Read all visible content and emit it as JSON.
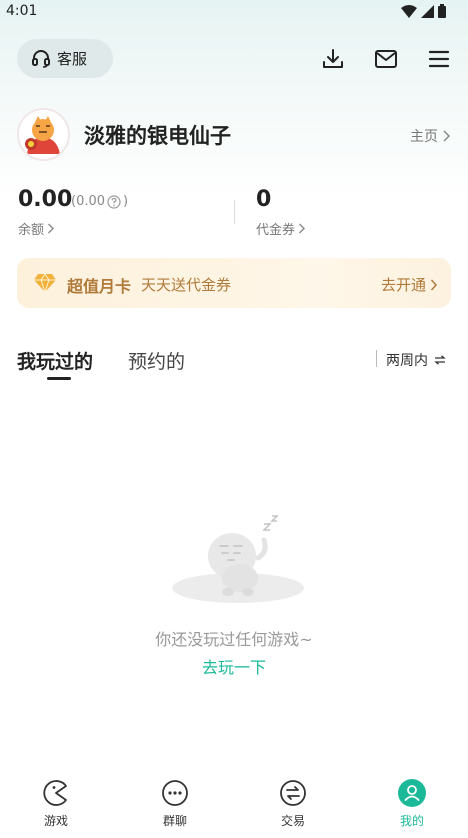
{
  "status_bar": {
    "time": "4:01"
  },
  "header": {
    "customer_service_label": "客服",
    "icons": [
      "download-icon",
      "mail-icon",
      "menu-icon"
    ]
  },
  "profile": {
    "nickname": "淡雅的银电仙子",
    "homepage_link": "主页"
  },
  "wallet": {
    "balance_value": "0.00",
    "balance_sub_value": "(0.00",
    "balance_sub_close": ")",
    "balance_label": "余额",
    "coupon_value": "0",
    "coupon_label": "代金券"
  },
  "vip_banner": {
    "title": "超值月卡",
    "subtitle": "天天送代金券",
    "action": "去开通"
  },
  "tabs": {
    "played": "我玩过的",
    "reserved": "预约的",
    "filter": "两周内"
  },
  "empty_state": {
    "message": "你还没玩过任何游戏~",
    "link": "去玩一下"
  },
  "bottom_nav": {
    "items": [
      {
        "label": "游戏",
        "icon": "pacman-icon"
      },
      {
        "label": "群聊",
        "icon": "chat-bubble-icon"
      },
      {
        "label": "交易",
        "icon": "exchange-icon"
      },
      {
        "label": "我的",
        "icon": "user-icon"
      }
    ],
    "active_index": 3
  },
  "colors": {
    "accent": "#1bb99a",
    "vip_text": "#b07a3a"
  }
}
